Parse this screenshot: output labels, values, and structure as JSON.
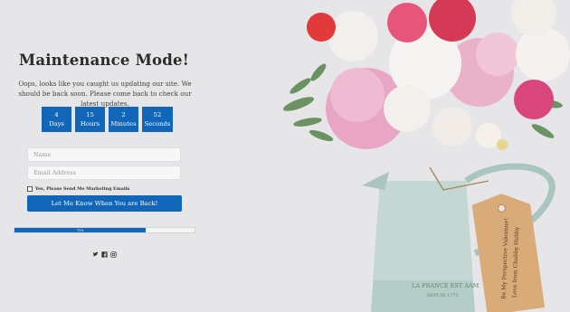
{
  "heading": "Maintenance Mode!",
  "description": "Oops, looks like you caught us updating our site. We should be back soon. Please come back to check our latest updates.",
  "countdown": [
    {
      "value": "4",
      "unit": "Days"
    },
    {
      "value": "15",
      "unit": "Hours"
    },
    {
      "value": "2",
      "unit": "Minutes"
    },
    {
      "value": "52",
      "unit": "Seconds"
    }
  ],
  "form": {
    "name_placeholder": "Name",
    "email_placeholder": "Email Address",
    "marketing_label": "Yes, Please Send Me Marketing Emails",
    "submit_label": "Let Me Know When You are Back!"
  },
  "progress": {
    "value": 0.73,
    "label": "73%"
  },
  "social": [
    "twitter-icon",
    "facebook-icon",
    "instagram-icon"
  ],
  "photo": {
    "tag_text_line1": "Be My Perspective Valentine!",
    "tag_text_line2": "Love from Chubby Hubby",
    "jug_text_line1": "LA FRANCE EST AAM",
    "jug_text_line2": "DEPUIS 1775"
  },
  "colors": {
    "accent": "#1266b8",
    "background": "#e6e5e8"
  }
}
